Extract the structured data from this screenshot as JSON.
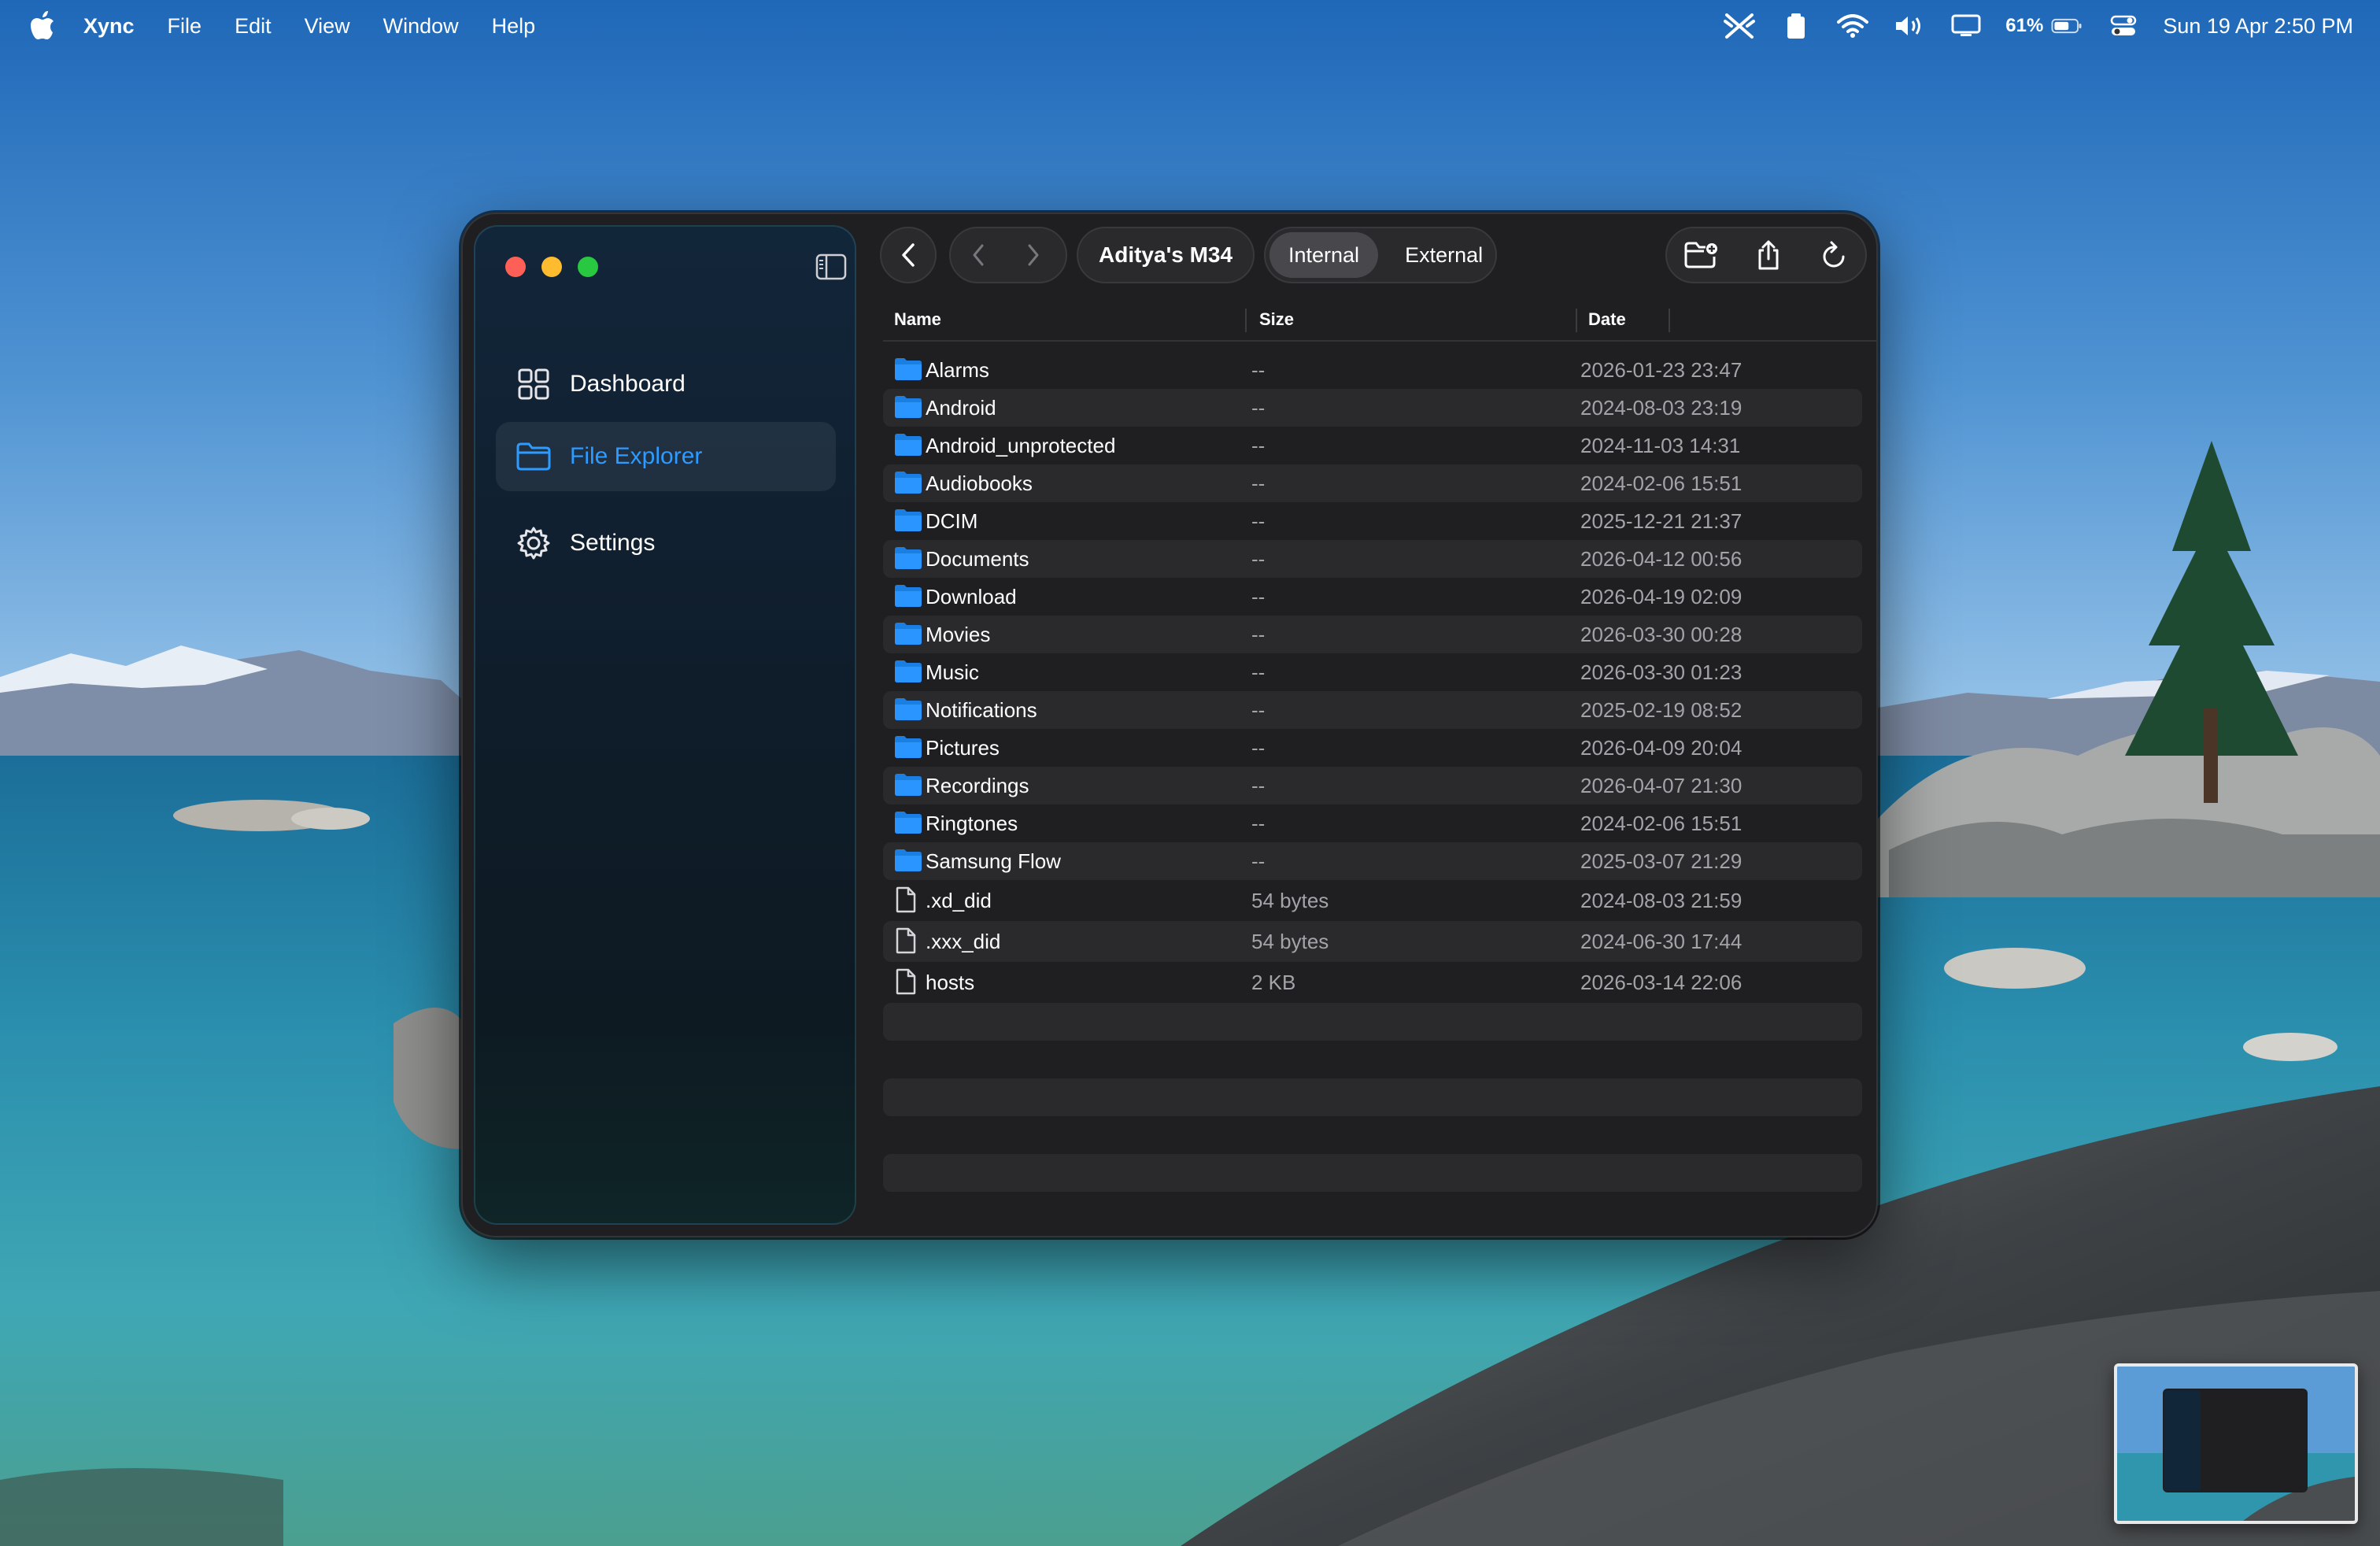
{
  "menubar": {
    "app_name": "Xync",
    "menus": [
      "File",
      "Edit",
      "View",
      "Window",
      "Help"
    ],
    "battery_percent": "61%",
    "clock": "Sun 19 Apr  2:50 PM"
  },
  "sidebar": {
    "items": [
      {
        "label": "Dashboard",
        "icon": "grid-icon"
      },
      {
        "label": "File Explorer",
        "icon": "folder-icon"
      },
      {
        "label": "Settings",
        "icon": "gear-icon"
      }
    ]
  },
  "toolbar": {
    "device_name": "Aditya's M34",
    "storage_tabs": [
      "Internal",
      "External"
    ],
    "selected_storage": "Internal"
  },
  "table": {
    "columns": [
      "Name",
      "Size",
      "Date"
    ],
    "rows": [
      {
        "type": "folder",
        "name": "Alarms",
        "size": "--",
        "date": "2026-01-23 23:47"
      },
      {
        "type": "folder",
        "name": "Android",
        "size": "--",
        "date": "2024-08-03 23:19"
      },
      {
        "type": "folder",
        "name": "Android_unprotected",
        "size": "--",
        "date": "2024-11-03 14:31"
      },
      {
        "type": "folder",
        "name": "Audiobooks",
        "size": "--",
        "date": "2024-02-06 15:51"
      },
      {
        "type": "folder",
        "name": "DCIM",
        "size": "--",
        "date": "2025-12-21 21:37"
      },
      {
        "type": "folder",
        "name": "Documents",
        "size": "--",
        "date": "2026-04-12 00:56"
      },
      {
        "type": "folder",
        "name": "Download",
        "size": "--",
        "date": "2026-04-19 02:09"
      },
      {
        "type": "folder",
        "name": "Movies",
        "size": "--",
        "date": "2026-03-30 00:28"
      },
      {
        "type": "folder",
        "name": "Music",
        "size": "--",
        "date": "2026-03-30 01:23"
      },
      {
        "type": "folder",
        "name": "Notifications",
        "size": "--",
        "date": "2025-02-19 08:52"
      },
      {
        "type": "folder",
        "name": "Pictures",
        "size": "--",
        "date": "2026-04-09 20:04"
      },
      {
        "type": "folder",
        "name": "Recordings",
        "size": "--",
        "date": "2026-04-07 21:30"
      },
      {
        "type": "folder",
        "name": "Ringtones",
        "size": "--",
        "date": "2024-02-06 15:51"
      },
      {
        "type": "folder",
        "name": "Samsung Flow",
        "size": "--",
        "date": "2025-03-07 21:29"
      },
      {
        "type": "file",
        "name": ".xd_did",
        "size": "54 bytes",
        "date": "2024-08-03 21:59"
      },
      {
        "type": "file",
        "name": ".xxx_did",
        "size": "54 bytes",
        "date": "2024-06-30 17:44"
      },
      {
        "type": "file",
        "name": "hosts",
        "size": "2 KB",
        "date": "2026-03-14 22:06"
      }
    ]
  },
  "colors": {
    "accent": "#2d9bff",
    "folder": "#1e90ff",
    "window_bg": "#1f1f21",
    "row_alt": "#2a2a2d"
  }
}
